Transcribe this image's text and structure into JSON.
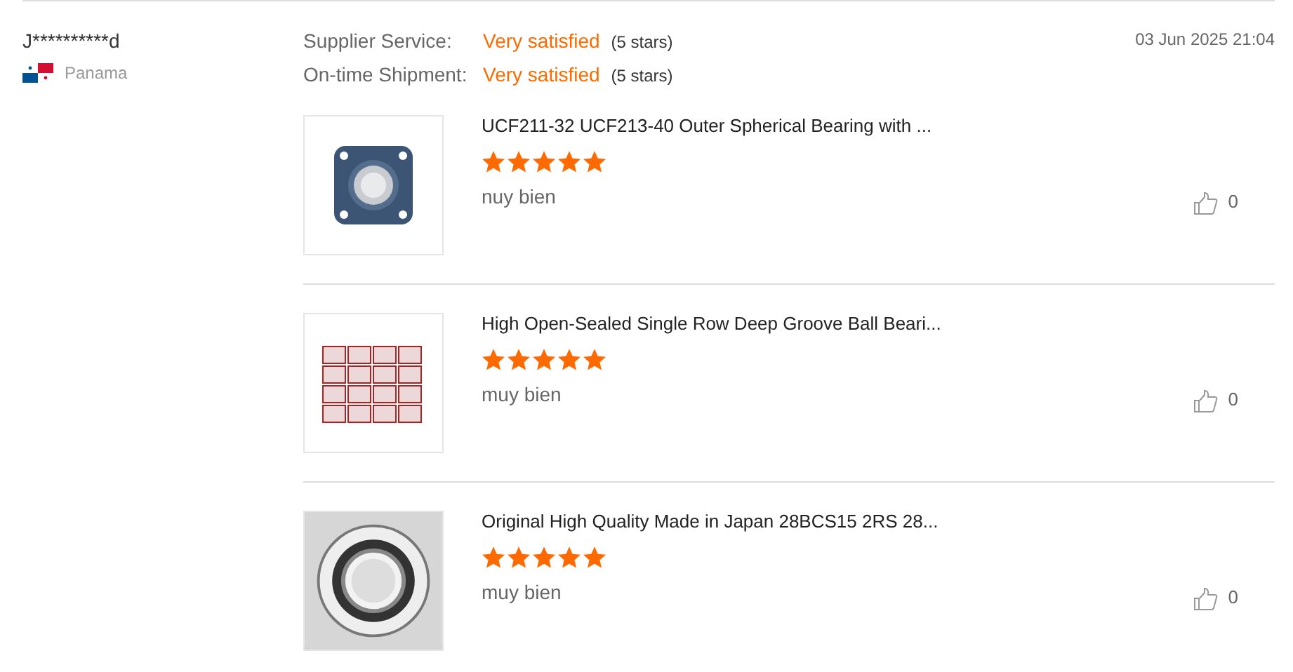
{
  "reviewer": {
    "name": "J**********d",
    "country": "Panama"
  },
  "ratings": [
    {
      "label": "Supplier Service:",
      "value": "Very satisfied",
      "stars_text": "(5 stars)"
    },
    {
      "label": "On-time Shipment:",
      "value": "Very satisfied",
      "stars_text": "(5 stars)"
    }
  ],
  "date": "03 Jun 2025 21:04",
  "products": [
    {
      "kind": "flange",
      "title": "UCF211-32 UCF213-40 Outer Spherical Bearing with ...",
      "stars": 5,
      "comment": "nuy bien",
      "likes": "0"
    },
    {
      "kind": "boxes",
      "title": "High Open-Sealed Single Row Deep Groove Ball Beari...",
      "stars": 5,
      "comment": "muy bien",
      "likes": "0"
    },
    {
      "kind": "ball",
      "title": "Original High Quality Made in Japan 28BCS15 2RS 28...",
      "stars": 5,
      "comment": "muy bien",
      "likes": "0"
    }
  ]
}
